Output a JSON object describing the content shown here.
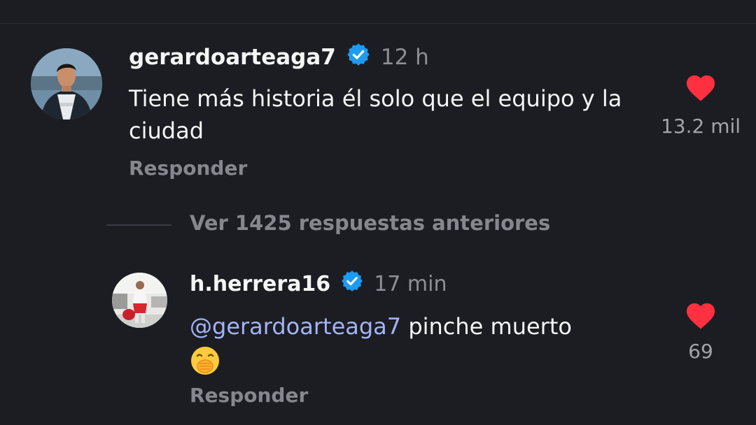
{
  "colors": {
    "background": "#1c1d22",
    "text_primary": "#f5f5f5",
    "text_secondary": "#86878e",
    "mention": "#a4b3f5",
    "verified_badge": "#1d9bf0",
    "heart": "#ff3040"
  },
  "comments": [
    {
      "username": "gerardoarteaga7",
      "verified": true,
      "time": "12 h",
      "text": "Tiene más historia él solo que el equipo y la ciudad",
      "reply_label": "Responder",
      "likes": "13.2 mil",
      "liked": true,
      "avatar_icon": "user-avatar-photo"
    },
    {
      "username": "h.herrera16",
      "verified": true,
      "time": "17 min",
      "mention": "@gerardoarteaga7",
      "text": " pinche muerto",
      "emoji": "🫢",
      "reply_label": "Responder",
      "likes": "69",
      "liked": true,
      "avatar_icon": "user-avatar-photo"
    }
  ],
  "thread": {
    "view_previous_label": "Ver 1425 respuestas anteriores"
  },
  "icons": {
    "verified": "verified-badge-icon",
    "like": "heart-icon",
    "emoji": "hand-over-mouth-emoji"
  }
}
